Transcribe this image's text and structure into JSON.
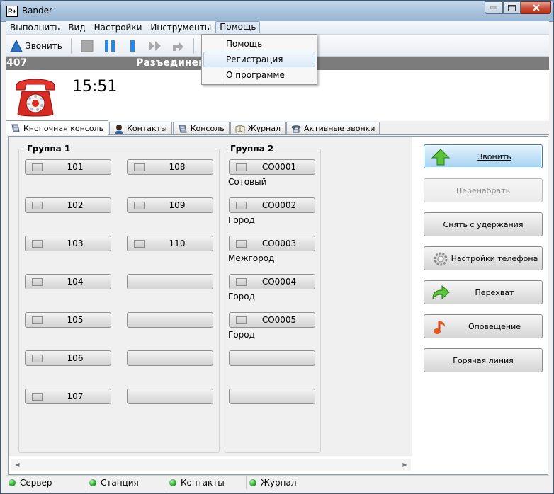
{
  "window": {
    "title": "Rander",
    "icon_text": "R+"
  },
  "menu": {
    "items": [
      "Выполнить",
      "Вид",
      "Настройки",
      "Инструменты",
      "Помощь"
    ],
    "open_index": 4
  },
  "help_menu": {
    "items": [
      "Помощь",
      "Регистрация",
      "О программе"
    ],
    "highlighted": 1
  },
  "toolbar": {
    "call_label": "Звонить"
  },
  "status": {
    "number": "407",
    "state": "Разъединен"
  },
  "clock": "15:51",
  "tabs": [
    {
      "label": "Кнопочная консоль",
      "icon": "console-icon",
      "active": true
    },
    {
      "label": "Контакты",
      "icon": "contacts-icon"
    },
    {
      "label": "Консоль",
      "icon": "console-icon"
    },
    {
      "label": "Журнал",
      "icon": "journal-icon"
    },
    {
      "label": "Активные звонки",
      "icon": "active-calls-icon"
    }
  ],
  "group1": {
    "title": "Группа 1",
    "col1": [
      "101",
      "102",
      "103",
      "104",
      "105",
      "106",
      "107"
    ],
    "col2": [
      "108",
      "109",
      "110",
      "",
      "",
      "",
      ""
    ]
  },
  "group2": {
    "title": "Группа 2",
    "buttons": [
      "CO0001",
      "CO0002",
      "CO0003",
      "CO0004",
      "CO0005",
      "",
      ""
    ],
    "sublabels": [
      "Сотовый",
      "Город",
      "Межгород",
      "Город",
      "Город",
      "",
      ""
    ]
  },
  "actions": [
    {
      "label": "Звонить",
      "icon": "green-up-arrow-icon",
      "state": "primary"
    },
    {
      "label": "Перенабрать",
      "icon": "",
      "state": "disabled"
    },
    {
      "label": "Снять с удержания",
      "icon": "",
      "state": "normal"
    },
    {
      "label": "Настройки телефона",
      "icon": "gear-icon",
      "state": "normal"
    },
    {
      "label": "Перехват",
      "icon": "green-forward-arrow-icon",
      "state": "normal"
    },
    {
      "label": "Оповещение",
      "icon": "music-note-icon",
      "state": "normal"
    },
    {
      "label": "Горячая линия",
      "icon": "",
      "state": "normal"
    }
  ],
  "statusbar": [
    "Сервер",
    "Станция",
    "Контакты",
    "Журнал"
  ],
  "colors": {
    "status_bg": "#7c7c7c",
    "indicator_green": "#23a52a",
    "primary_button": "#c4e2f7"
  }
}
